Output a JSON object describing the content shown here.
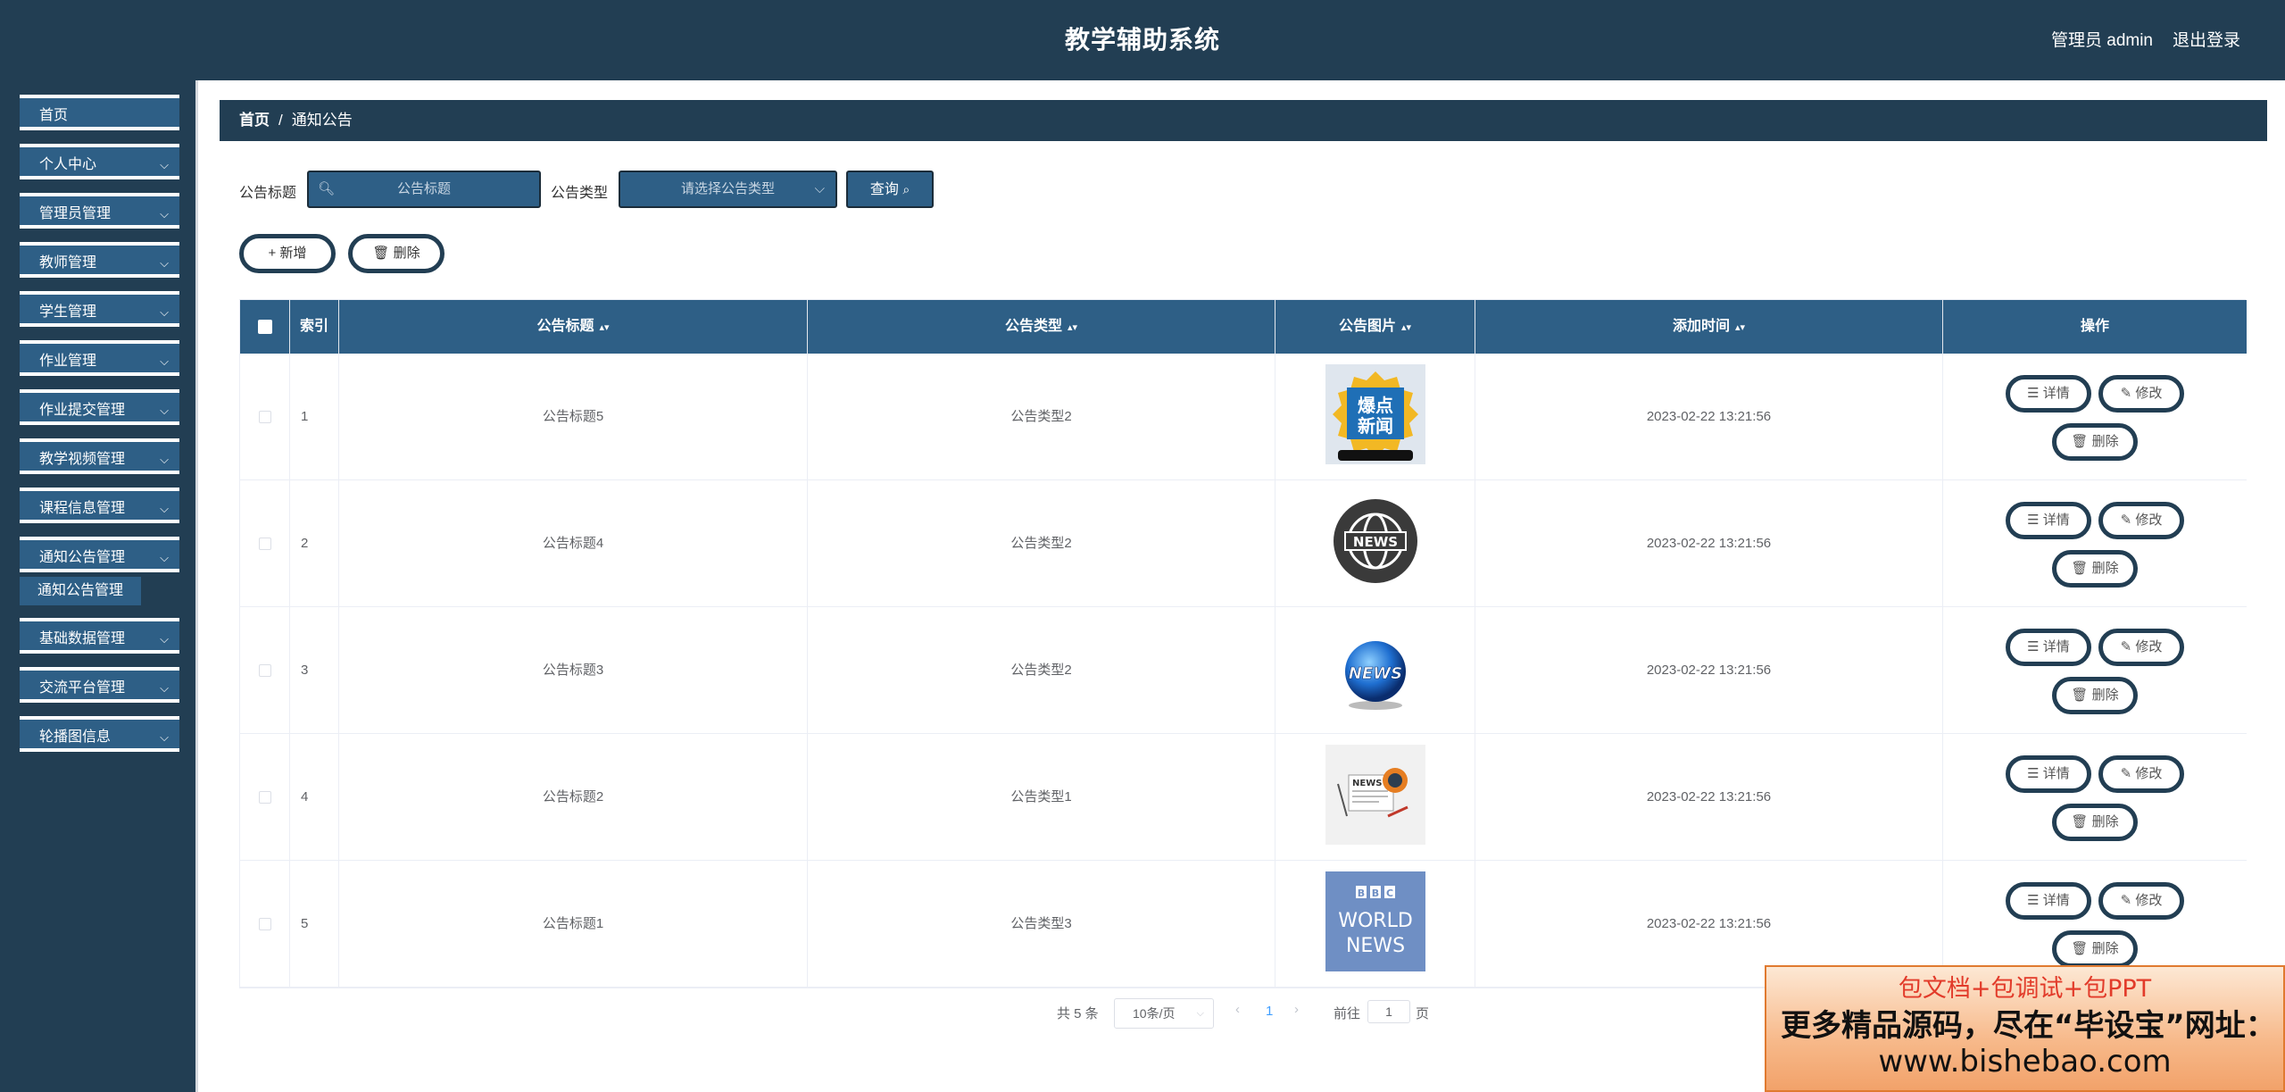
{
  "header": {
    "title": "教学辅助系统",
    "user": "管理员 admin",
    "logout": "退出登录"
  },
  "sidebar": {
    "items": [
      {
        "label": "首页",
        "has_children": false
      },
      {
        "label": "个人中心",
        "has_children": true
      },
      {
        "label": "管理员管理",
        "has_children": true
      },
      {
        "label": "教师管理",
        "has_children": true
      },
      {
        "label": "学生管理",
        "has_children": true
      },
      {
        "label": "作业管理",
        "has_children": true
      },
      {
        "label": "作业提交管理",
        "has_children": true
      },
      {
        "label": "教学视频管理",
        "has_children": true
      },
      {
        "label": "课程信息管理",
        "has_children": true
      },
      {
        "label": "通知公告管理",
        "has_children": true,
        "expanded": true
      },
      {
        "label": "基础数据管理",
        "has_children": true
      },
      {
        "label": "交流平台管理",
        "has_children": true
      },
      {
        "label": "轮播图信息",
        "has_children": true
      }
    ],
    "sub_item": "通知公告管理",
    "chevron": "chevron-down-icon"
  },
  "breadcrumb": {
    "home": "首页",
    "separator": "/",
    "current": "通知公告"
  },
  "search": {
    "title_label": "公告标题",
    "title_placeholder": "公告标题",
    "type_label": "公告类型",
    "type_placeholder": "请选择公告类型",
    "query_button": "查询"
  },
  "actions": {
    "add": "新增",
    "delete": "删除"
  },
  "table": {
    "columns": [
      "索引",
      "公告标题",
      "公告类型",
      "公告图片",
      "添加时间",
      "操作"
    ],
    "rows": [
      {
        "index": "1",
        "title": "公告标题5",
        "type": "公告类型2",
        "image": "news-badge-image",
        "time": "2023-02-22 13:21:56"
      },
      {
        "index": "2",
        "title": "公告标题4",
        "type": "公告类型2",
        "image": "news-globe-icon-image",
        "time": "2023-02-22 13:21:56"
      },
      {
        "index": "3",
        "title": "公告标题3",
        "type": "公告类型2",
        "image": "news-blue-globe-image",
        "time": "2023-02-22 13:21:56"
      },
      {
        "index": "4",
        "title": "公告标题2",
        "type": "公告类型1",
        "image": "newspaper-image",
        "time": "2023-02-22 13:21:56"
      },
      {
        "index": "5",
        "title": "公告标题1",
        "type": "公告类型3",
        "image": "bbc-world-news-image",
        "time": "2023-02-22 13:21:56"
      }
    ],
    "op_detail": "详情",
    "op_edit": "修改",
    "op_delete": "删除",
    "thumb_texts": {
      "badge": "爆点\n新闻",
      "globe": "NEWS",
      "blue_globe": "NEWS",
      "bbc_line1": "BBC",
      "bbc_line2": "WORLD",
      "bbc_line3": "NEWS"
    }
  },
  "pagination": {
    "total": "共 5 条",
    "page_size": "10条/页",
    "current_page": "1",
    "goto_label": "前往",
    "goto_value": "1",
    "page_suffix": "页"
  },
  "banner": {
    "line1": "包文档+包调试+包PPT",
    "line2": "更多精品源码，尽在“毕设宝”网址：",
    "line3": "www.bishebao.com"
  },
  "colors": {
    "header_bg": "#223e53",
    "accent": "#2e5f86",
    "border": "#ebeef5"
  }
}
